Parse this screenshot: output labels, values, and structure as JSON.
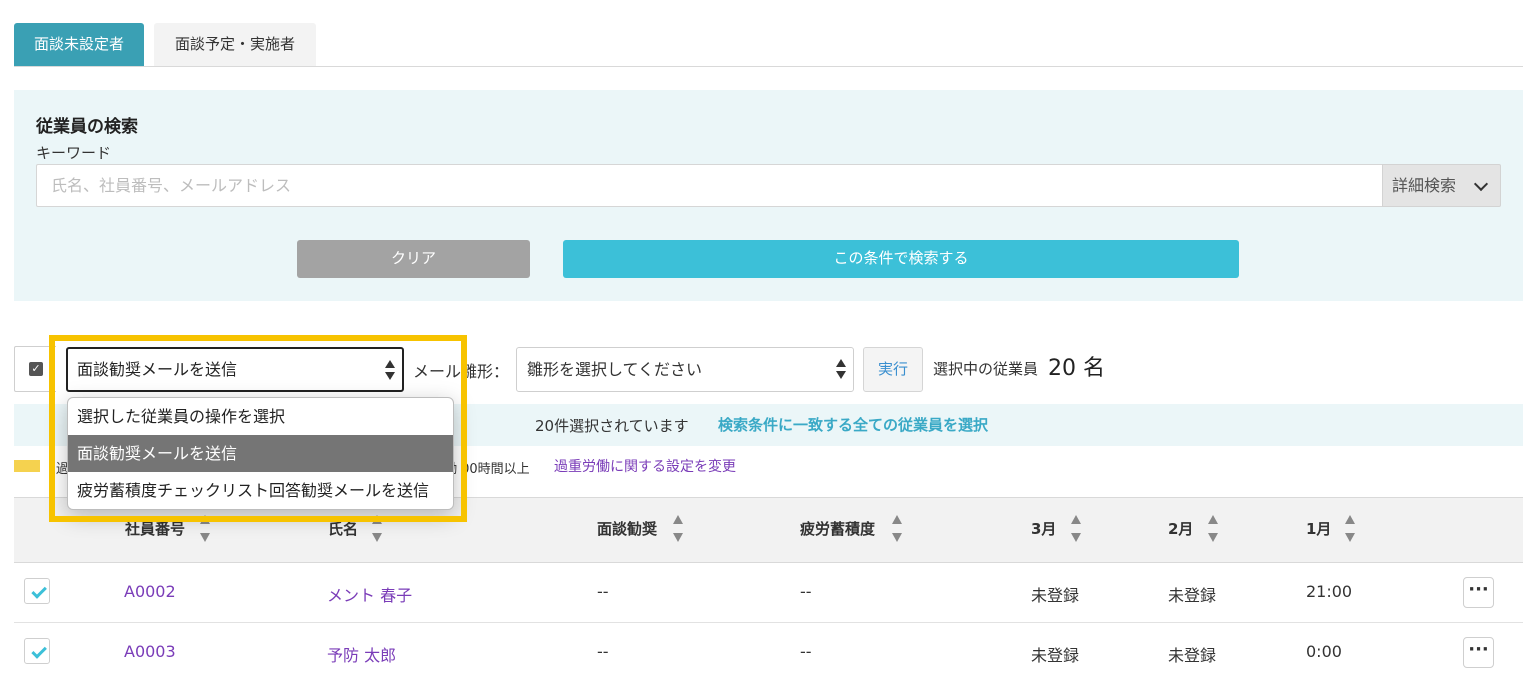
{
  "tabs": [
    {
      "label": "面談未設定者"
    },
    {
      "label": "面談予定・実施者"
    }
  ],
  "search": {
    "title": "従業員の検索",
    "keyword_label": "キーワード",
    "placeholder": "氏名、社員番号、メールアドレス",
    "detail_button": "詳細検索",
    "clear_button": "クリア",
    "search_button": "この条件で検索する"
  },
  "actions": {
    "operation_selected": "面談勧奨メールを送信",
    "mail_label": "メール雛形：",
    "template_placeholder": "雛形を選択してください",
    "run_button": "実行",
    "selected_prefix": "選択中の従業員",
    "selected_count": "20 名"
  },
  "dropdown": {
    "options": [
      "選択した従業員の操作を選択",
      "面談勧奨メールを送信",
      "疲労蓄積度チェックリスト回答勧奨メールを送信"
    ]
  },
  "selection_bar": {
    "text": "20件選択されています",
    "select_all_link": "検索条件に一致する全ての従業員を選択"
  },
  "legend": {
    "text_left": "過",
    "text_right": "働 00時間以上",
    "settings_link": "過重労働に関する設定を変更",
    "swatch_color": "#f5d24f"
  },
  "table": {
    "headers": [
      "社員番号",
      "氏名",
      "面談勧奨",
      "疲労蓄積度",
      "3月",
      "2月",
      "1月"
    ],
    "rows": [
      {
        "id": "A0002",
        "name": "メント 春子",
        "interview": "--",
        "fatigue": "--",
        "m3": "未登録",
        "m2": "未登録",
        "m1": "21:00",
        "more": "···"
      },
      {
        "id": "A0003",
        "name": "予防 太郎",
        "interview": "--",
        "fatigue": "--",
        "m3": "未登録",
        "m2": "未登録",
        "m1": "0:00",
        "more": "···"
      }
    ]
  },
  "colors": {
    "accent_tab": "#3aa0b4",
    "search_button": "#3cc0d8",
    "highlight": "#f7c300",
    "link": "#7a3cb8"
  }
}
